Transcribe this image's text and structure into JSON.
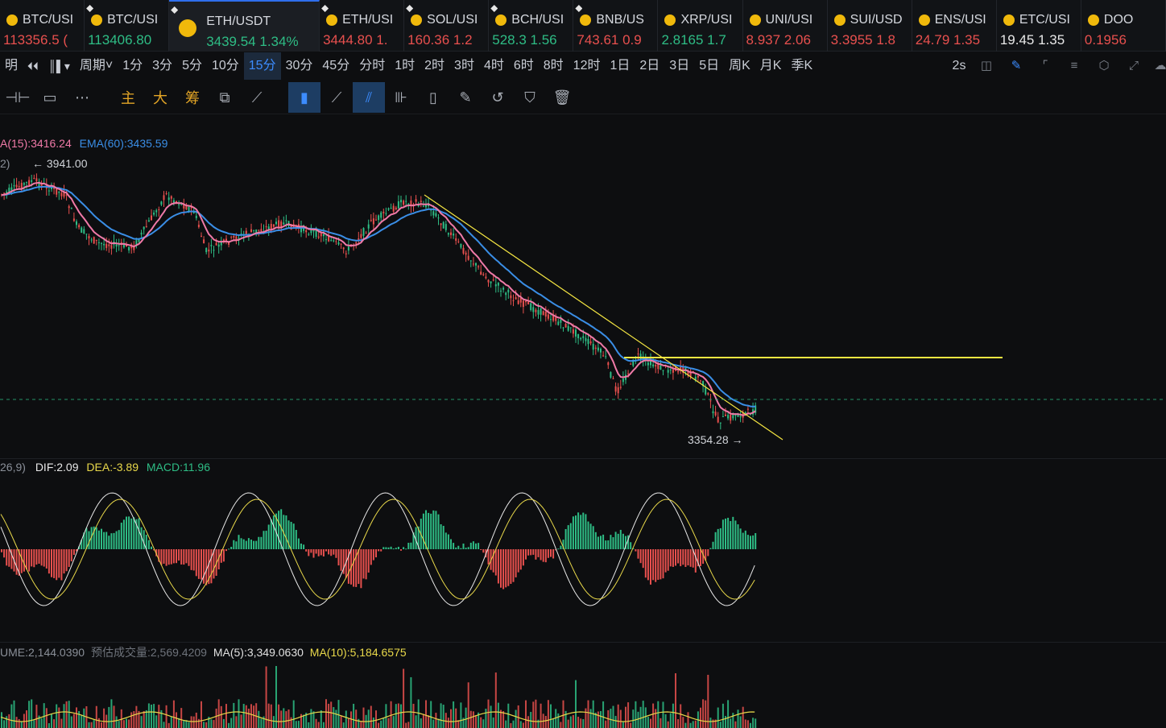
{
  "tickers": [
    {
      "symbol": "BTC/USI",
      "price": "113356.5 (",
      "trend": "down",
      "pinned": false
    },
    {
      "symbol": "BTC/USI",
      "price": "113406.80",
      "trend": "up",
      "pinned": true
    },
    {
      "symbol": "ETH/USDT",
      "price": "3439.54  1.34%",
      "trend": "up",
      "pinned": true,
      "active": true
    },
    {
      "symbol": "ETH/USI",
      "price": "3444.80  1.",
      "trend": "down",
      "pinned": true
    },
    {
      "symbol": "SOL/USI",
      "price": "160.36  1.2",
      "trend": "down",
      "pinned": true
    },
    {
      "symbol": "BCH/USI",
      "price": "528.3  1.56",
      "trend": "up",
      "pinned": true
    },
    {
      "symbol": "BNB/US",
      "price": "743.61  0.9",
      "trend": "down",
      "pinned": true
    },
    {
      "symbol": "XRP/USI",
      "price": "2.8165  1.7",
      "trend": "up",
      "pinned": false
    },
    {
      "symbol": "UNI/USI",
      "price": "8.937  2.06",
      "trend": "down",
      "pinned": false
    },
    {
      "symbol": "SUI/USD",
      "price": "3.3955  1.8",
      "trend": "down",
      "pinned": false
    },
    {
      "symbol": "ENS/USI",
      "price": "24.79  1.35",
      "trend": "down",
      "pinned": false
    },
    {
      "symbol": "ETC/USI",
      "price": "19.45  1.35",
      "trend": "neutral",
      "pinned": false
    },
    {
      "symbol": "DOO",
      "price": "0.1956",
      "trend": "down",
      "pinned": false
    }
  ],
  "period_bar": {
    "layout_label": "明",
    "chart_type_label": "",
    "period_label": "周期",
    "periods": [
      "1分",
      "3分",
      "5分",
      "10分",
      "15分",
      "30分",
      "45分",
      "分时",
      "1时",
      "2时",
      "3时",
      "4时",
      "6时",
      "8时",
      "12时",
      "1日",
      "2日",
      "3日",
      "5日",
      "周K",
      "月K",
      "季K"
    ],
    "selected_period": "15分",
    "refresh": "2s"
  },
  "draw_toolbar": {
    "labels": [
      "主",
      "大",
      "筹"
    ]
  },
  "main_pane": {
    "ema15_label": "A(15):3416.24",
    "ema60_label": "EMA(60):3435.59",
    "prefix_label": "2)",
    "high_label": "← 3941.00",
    "low_label": "3354.28  →"
  },
  "macd_pane": {
    "params_label": "26,9)",
    "dif_label": "DIF:2.09",
    "dea_label": "DEA:-3.89",
    "macd_label": "MACD:11.96"
  },
  "volume_pane": {
    "volume_label": "UME:2,144.0390",
    "est_label": "预估成交量:2,569.4209",
    "ma5_label": "MA(5):3,349.0630",
    "ma10_label": "MA(10):5,184.6575"
  },
  "colors": {
    "up": "#2ebd85",
    "down": "#e8504e",
    "ema_fast": "#f07aa8",
    "ema_slow": "#3a8ee6",
    "trendline": "#f5e642",
    "accent": "#3c8cff",
    "dea": "#e8d84a",
    "dif": "#e8e8e8"
  }
}
